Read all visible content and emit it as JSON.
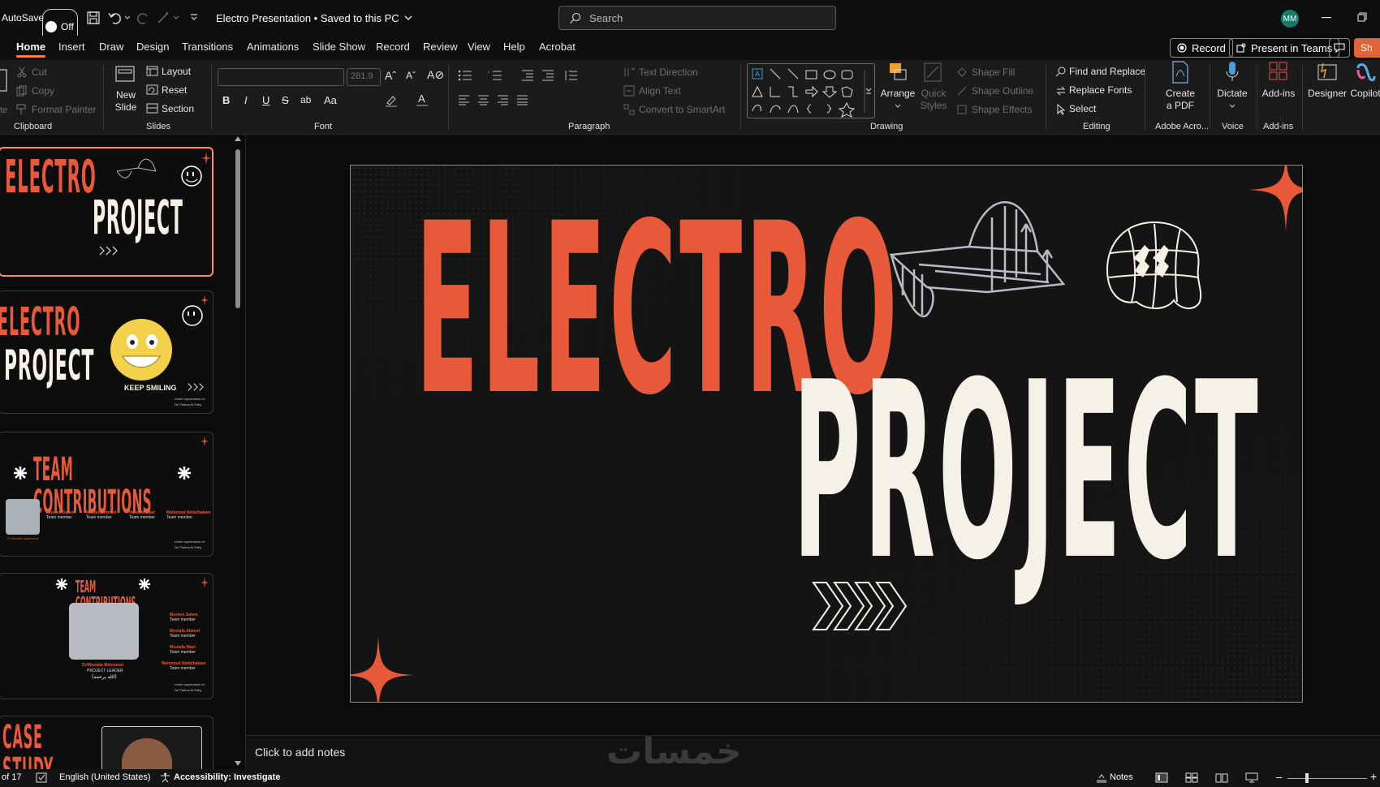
{
  "titlebar": {
    "autosave_label": "AutoSave",
    "autosave_state": "Off",
    "document_title": "Electro Presentation • Saved to this PC",
    "search_placeholder": "Search",
    "user_initials": "MM"
  },
  "tabs": [
    "Home",
    "Insert",
    "Draw",
    "Design",
    "Transitions",
    "Animations",
    "Slide Show",
    "Record",
    "Review",
    "View",
    "Help",
    "Acrobat"
  ],
  "active_tab": "Home",
  "tab_actions": {
    "record": "Record",
    "present_teams": "Present in Teams",
    "share": "Sh"
  },
  "ribbon": {
    "clipboard": {
      "cut": "Cut",
      "copy": "Copy",
      "format_painter": "Format Painter",
      "paste_fragment": "te",
      "label": "Clipboard"
    },
    "slides": {
      "new_slide_line1": "New",
      "new_slide_line2": "Slide",
      "layout": "Layout",
      "reset": "Reset",
      "section": "Section",
      "label": "Slides"
    },
    "font": {
      "font_name": "",
      "font_size": "281.9",
      "label": "Font"
    },
    "paragraph": {
      "text_direction": "Text Direction",
      "align_text": "Align Text",
      "convert_smartart": "Convert to SmartArt",
      "label": "Paragraph"
    },
    "drawing": {
      "arrange": "Arrange",
      "quick_styles_line1": "Quick",
      "quick_styles_line2": "Styles",
      "shape_fill": "Shape Fill",
      "shape_outline": "Shape Outline",
      "shape_effects": "Shape Effects",
      "label": "Drawing"
    },
    "editing": {
      "find_replace": "Find and Replace",
      "replace_fonts": "Replace Fonts",
      "select": "Select",
      "label": "Editing"
    },
    "adobe": {
      "create_pdf_line1": "Create",
      "create_pdf_line2": "a PDF",
      "label": "Adobe Acro..."
    },
    "voice": {
      "dictate": "Dictate",
      "label": "Voice"
    },
    "addins": {
      "addins": "Add-ins",
      "label": "Add-ins"
    },
    "designer": "Designer",
    "copilot": "Copilot"
  },
  "thumbnails": [
    {
      "title_line1": "ELECTRO",
      "title_line2": "PROJECT"
    },
    {
      "title_line1": "ELECTRO",
      "title_line2": "PROJECT",
      "caption": "KEEP SMILING",
      "footer_line1": "Under supervision of:",
      "footer_line2": "Dr/ Fatima Al-Fahy"
    },
    {
      "title": "TEAM CONTRIBUTIONS",
      "members": [
        "Moslem Salem",
        "Mostafa Ahmed",
        "Mostafa Wael",
        "Mahmoud Abdelhakam"
      ],
      "role": "Team member",
      "leader": "Dr/Mostafa Mahmoud",
      "footer_line1": "Under supervision of:",
      "footer_line2": "Dr/ Fatima Al-Fahy"
    },
    {
      "title": "TEAM CONTRIBUTIONS",
      "members": [
        "Moslem Salem",
        "Mostafa Ahmed",
        "Mostafa Wael",
        "Mahmoud Abdelhakam"
      ],
      "role": "Team member",
      "leader": "Dr/Mostafa Mahmoud",
      "leader_role": "PROJECT LEADER",
      "leader_arabic": "(الله يرحمه)",
      "footer_line1": "Under supervision of:",
      "footer_line2": "Dr/ Fatima Al-Fahy"
    },
    {
      "title": "CASE STUDY"
    }
  ],
  "slide": {
    "title_line1": "ELECTRO",
    "title_line2": "PROJECT",
    "accent_color": "#e8593a",
    "text_color": "#f5f1e6",
    "background": "#141414"
  },
  "notes_placeholder": "Click to add notes",
  "watermark": "خمسات",
  "status": {
    "slide_counter": "of 17",
    "language": "English (United States)",
    "accessibility": "Accessibility: Investigate",
    "notes": "Notes"
  }
}
